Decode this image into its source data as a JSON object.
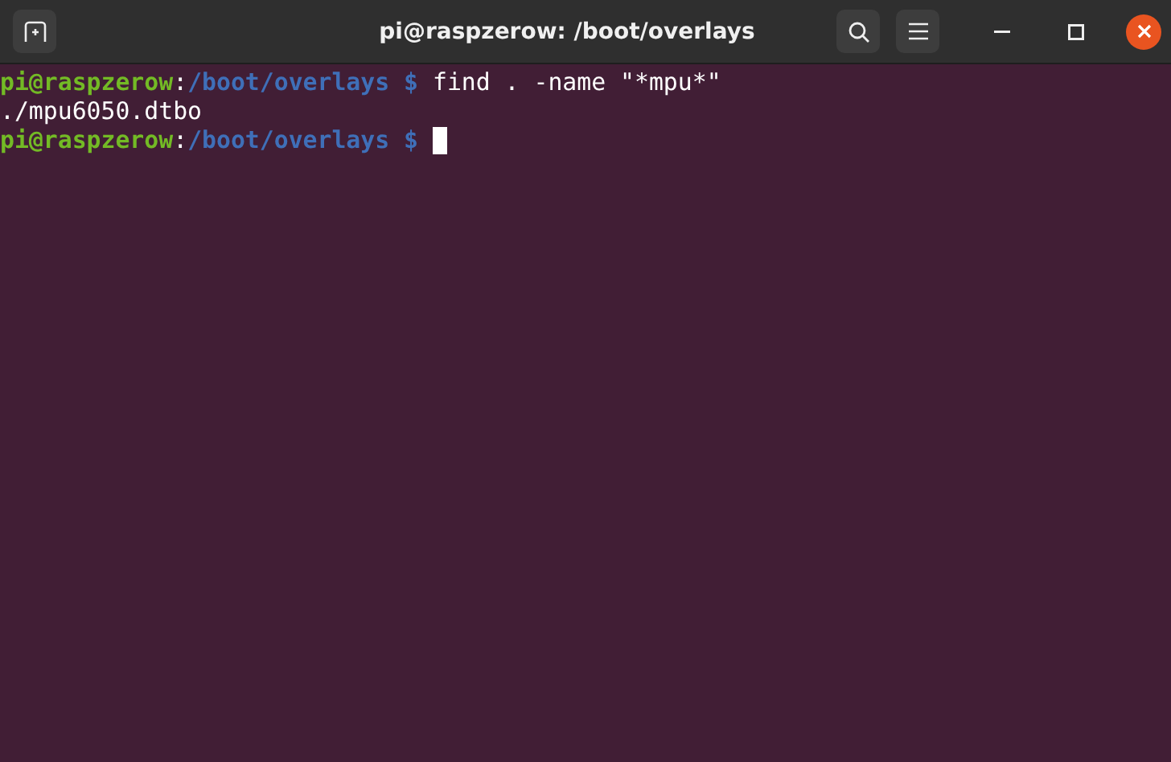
{
  "window": {
    "title": "pi@raspzerow: /boot/overlays"
  },
  "lines": [
    {
      "kind": "prompt",
      "user_host": "pi@raspzerow",
      "separator": ":",
      "path": "/boot/overlays",
      "symbol": "$",
      "command": "find . -name \"*mpu*\"",
      "cursor": false
    },
    {
      "kind": "output",
      "text": "./mpu6050.dtbo"
    },
    {
      "kind": "prompt",
      "user_host": "pi@raspzerow",
      "separator": ":",
      "path": "/boot/overlays",
      "symbol": "$",
      "cursor": true
    }
  ]
}
